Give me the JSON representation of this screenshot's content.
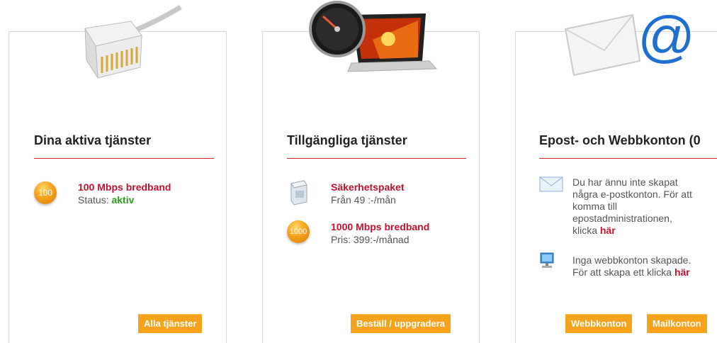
{
  "cards": [
    {
      "title": "Dina aktiva tjänster",
      "items": [
        {
          "badge": "100",
          "title": "100 Mbps bredband",
          "status_label": "Status:",
          "status_value": "aktiv"
        }
      ],
      "button": "Alla tjänster"
    },
    {
      "title": "Tillgängliga tjänster",
      "items": [
        {
          "title": "Säkerhetspaket",
          "sub": "Från 49 :-/mån"
        },
        {
          "badge": "1000",
          "title": "1000 Mbps bredband",
          "sub": "Pris: 399:-/månad"
        }
      ],
      "button": "Beställ / uppgradera"
    },
    {
      "title": "Epost- och Webbkonton (0",
      "items": [
        {
          "lines": [
            "Du har ännu inte skapat",
            "några e-postkonton. För att",
            "komma till",
            "epostadministrationen,"
          ],
          "last": "klicka",
          "link": "här"
        },
        {
          "lines": [
            "Inga webbkonton skapade."
          ],
          "last": "För att skapa ett klicka",
          "link": "här"
        }
      ],
      "buttons": [
        "Webbkonton",
        "Mailkonton"
      ]
    }
  ],
  "colors": {
    "accent": "#f7a21b",
    "title_red": "#c8102e",
    "status_green": "#2a9d1c",
    "divider": "#d2232a"
  }
}
